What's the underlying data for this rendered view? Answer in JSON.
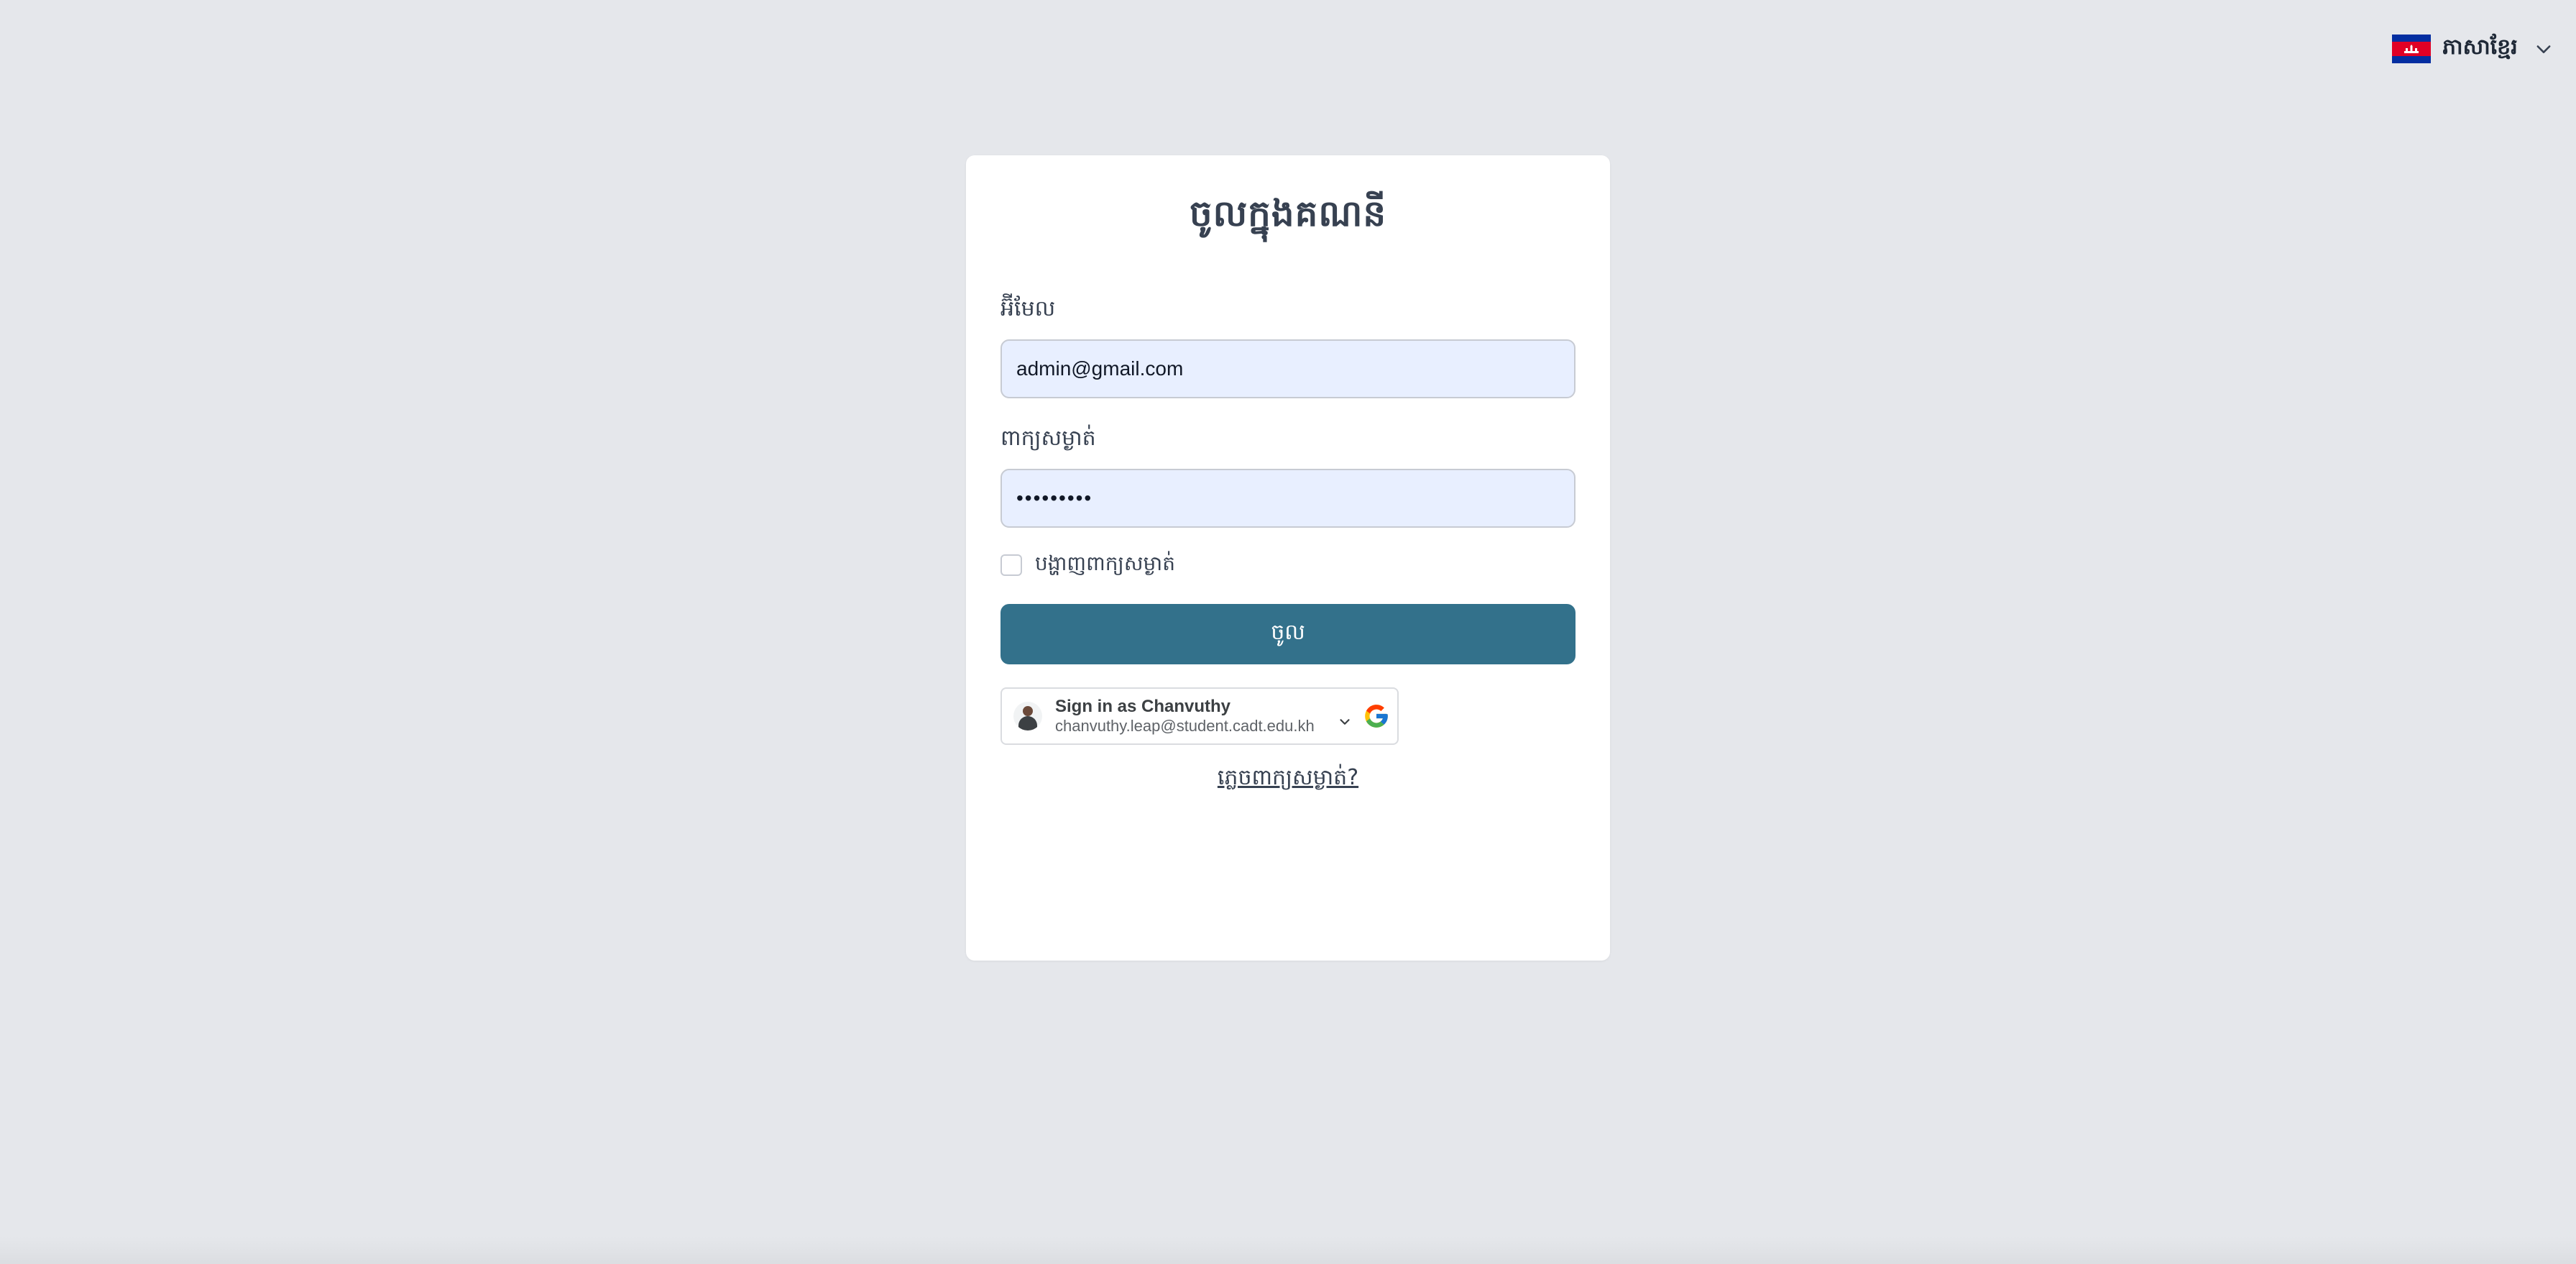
{
  "language_switcher": {
    "label": "ភាសាខ្មែរ",
    "flag_icon": "cambodia-flag-icon",
    "chevron_icon": "chevron-down-icon"
  },
  "login_form": {
    "title": "ចូលក្នុងគណនី",
    "email": {
      "label": "អ៊ីមែល",
      "value": "admin@gmail.com"
    },
    "password": {
      "label": "ពាក្យសម្ងាត់",
      "value": "•••••••••"
    },
    "show_password": {
      "label": "បង្ហាញពាក្យសម្ងាត់",
      "checked": false
    },
    "submit_label": "ចូល",
    "forgot_password_label": "ភ្លេចពាក្យសម្ងាត់?"
  },
  "google_signin": {
    "title": "Sign in as Chanvuthy",
    "email": "chanvuthy.leap@student.cadt.edu.kh",
    "avatar_icon": "user-avatar",
    "logo_icon": "google-logo-icon"
  },
  "colors": {
    "background": "#e5e7eb",
    "card": "#ffffff",
    "primary_button": "#33718b",
    "input_fill": "#e8efff"
  }
}
